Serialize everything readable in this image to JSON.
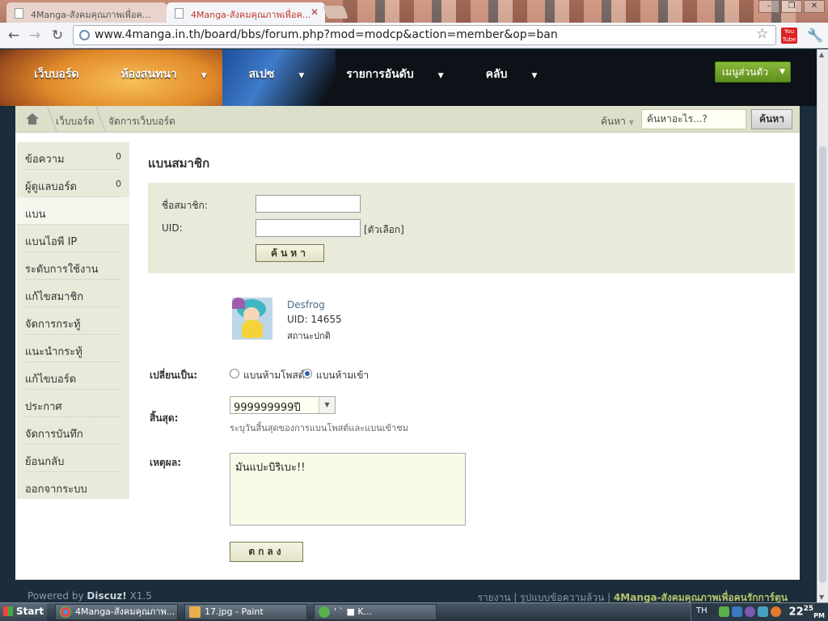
{
  "browser": {
    "tabs": [
      {
        "title": "4Manga-สังคมคุณภาพเพื่อค..."
      },
      {
        "title": "4Manga-สังคมคุณภาพเพื่อค..."
      }
    ],
    "url": "www.4manga.in.th/board/bbs/forum.php?mod=modcp&action=member&op=ban",
    "youtube_label": "You Tube"
  },
  "site_nav": {
    "items": [
      "เว็บบอร์ด",
      "ห้องสนทนา",
      "สเปซ",
      "รายการอันดับ",
      "คลับ"
    ],
    "personal_menu": "เมนูส่วนตัว"
  },
  "breadcrumb": {
    "items": [
      "เว็บบอร์ด",
      "จัดการเว็บบอร์ด"
    ],
    "search_label": "ค้นหา",
    "search_placeholder": "ค้นหาอะไร...?",
    "search_button": "ค้นหา"
  },
  "sidebar": {
    "items": [
      {
        "label": "ข้อความ",
        "count": "0"
      },
      {
        "label": "ผู้ดูแลบอร์ด",
        "count": "0"
      },
      {
        "label": "แบน",
        "count": ""
      },
      {
        "label": "แบนไอพี IP",
        "count": ""
      },
      {
        "label": "ระดับการใช้งาน",
        "count": ""
      },
      {
        "label": "แก้ไขสมาชิก",
        "count": ""
      },
      {
        "label": "จัดการกระทู้",
        "count": ""
      },
      {
        "label": "แนะนำกระทู้",
        "count": ""
      },
      {
        "label": "แก้ไขบอร์ด",
        "count": ""
      },
      {
        "label": "ประกาศ",
        "count": ""
      },
      {
        "label": "จัดการบันทึก",
        "count": ""
      },
      {
        "label": "ย้อนกลับ",
        "count": ""
      },
      {
        "label": "ออกจากระบบ",
        "count": ""
      }
    ],
    "active_index": 2
  },
  "page": {
    "title": "แบนสมาชิก",
    "search_form": {
      "username_label": "ชื่อสมาชิก:",
      "username_value": "",
      "uid_label": "UID:",
      "uid_value": "",
      "uid_hint": "[ตัวเลือก]",
      "submit": "ค้นหา"
    },
    "user": {
      "name": "Desfrog",
      "uid": "UID: 14655",
      "status": "สถานะปกติ"
    },
    "change_label": "เปลี่ยนเป็น:",
    "options": [
      {
        "label": "แบนห้ามโพสต์",
        "selected": false
      },
      {
        "label": "แบนห้ามเข้า",
        "selected": true
      }
    ],
    "expiry_label": "สิ้นสุด:",
    "expiry_value": "999999999ปี",
    "expiry_hint": "ระบุวันสิ้นสุดของการแบนโพสต์และแบนเข้าชม",
    "reason_label": "เหตุผล:",
    "reason_value": "มันแปะบิริเบะ!!",
    "submit": "ตกลง"
  },
  "footer": {
    "powered_by": "Powered by",
    "brand": "Discuz!",
    "version": "X1.5",
    "links": [
      "รายงาน",
      "รูปแบบข้อความล้วน"
    ],
    "site_name": "4Manga-สังคมคุณภาพเพื่อคนรักการ์ตูน"
  },
  "taskbar": {
    "start": "Start",
    "buttons": [
      "4Manga-สังคมคุณภาพ...",
      "17.jpg - Paint",
      "'                `  ■  K..."
    ],
    "lang": "TH",
    "time": "22",
    "time_min": "25",
    "ampm": "PM"
  },
  "colors": {
    "accent_green": "#6d9e24",
    "breadcrumb_bg": "#dcdfc9",
    "sidebar_bg": "#e9eada",
    "link_blue": "#4a6b8a"
  }
}
